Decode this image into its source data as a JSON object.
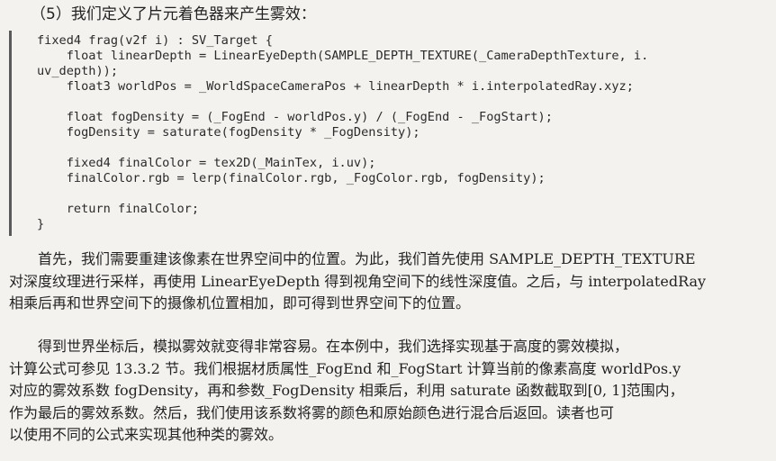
{
  "heading": "（5）我们定义了片元着色器来产生雾效：",
  "code_lines": [
    "fixed4 frag(v2f i) : SV_Target {",
    "    float linearDepth = LinearEyeDepth(SAMPLE_DEPTH_TEXTURE(_CameraDepthTexture, i.",
    "uv_depth));",
    "    float3 worldPos = _WorldSpaceCameraPos + linearDepth * i.interpolatedRay.xyz;",
    "",
    "    float fogDensity = (_FogEnd - worldPos.y) / (_FogEnd - _FogStart);",
    "    fogDensity = saturate(fogDensity * _FogDensity);",
    "",
    "    fixed4 finalColor = tex2D(_MainTex, i.uv);",
    "    finalColor.rgb = lerp(finalColor.rgb, _FogColor.rgb, fogDensity);",
    "",
    "    return finalColor;",
    "}"
  ],
  "paragraph1_lines": [
    "　　首先，我们需要重建该像素在世界空间中的位置。为此，我们首先使用 SAMPLE_DEPTH_TEXTURE",
    "对深度纹理进行采样，再使用 LinearEyeDepth 得到视角空间下的线性深度值。之后，与 interpolatedRay",
    "相乘后再和世界空间下的摄像机位置相加，即可得到世界空间下的位置。"
  ],
  "paragraph2_lines": [
    "　　得到世界坐标后，模拟雾效就变得非常容易。在本例中，我们选择实现基于高度的雾效模拟，",
    "计算公式可参见 13.3.2 节。我们根据材质属性_FogEnd 和_FogStart 计算当前的像素高度 worldPos.y",
    "对应的雾效系数 fogDensity，再和参数_FogDensity 相乘后，利用 saturate 函数截取到[0, 1]范围内，",
    "作为最后的雾效系数。然后，我们使用该系数将雾的颜色和原始颜色进行混合后返回。读者也可",
    "以使用不同的公式来实现其他种类的雾效。"
  ]
}
